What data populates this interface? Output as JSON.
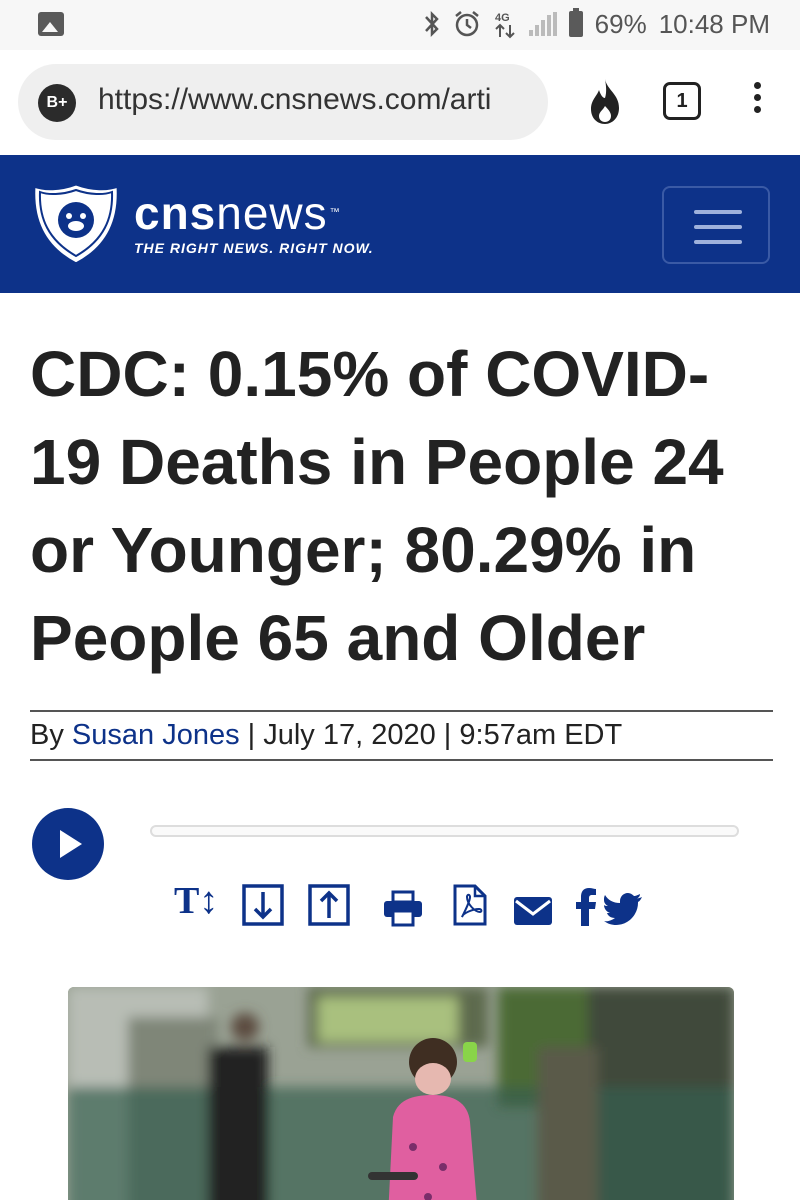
{
  "status_bar": {
    "left_icon": "image-notification-icon",
    "icons": [
      "bluetooth-icon",
      "alarm-icon",
      "4g-lte-icon",
      "signal-icon",
      "battery-icon"
    ],
    "battery": "69%",
    "time": "10:48 PM"
  },
  "browser": {
    "badge": "B+",
    "url": "https://www.cnsnews.com/arti",
    "tab_count": "1",
    "icons": [
      "flame-icon",
      "tab-switcher-icon",
      "menu-kebab-icon"
    ]
  },
  "site": {
    "logo_word_bold": "cns",
    "logo_word_light": "news",
    "logo_tm": "™",
    "tagline": "THE RIGHT NEWS. RIGHT NOW.",
    "brand_color": "#0d3289"
  },
  "article": {
    "headline": "CDC: 0.15% of COVID-19 Deaths in People 24 or Younger; 80.29% in People 65 and Older",
    "byline_prefix": "By ",
    "author": "Susan Jones",
    "separator_1": " | ",
    "date": "July 17, 2020",
    "separator_2": " | ",
    "time": "9:57am EDT"
  },
  "audio": {
    "progress_fraction": 0
  },
  "tools": {
    "text_size_label": "T↕",
    "items": [
      "text-size-icon",
      "scroll-down-icon",
      "scroll-up-icon",
      "print-icon",
      "pdf-icon",
      "email-icon",
      "facebook-icon",
      "twitter-icon"
    ]
  }
}
